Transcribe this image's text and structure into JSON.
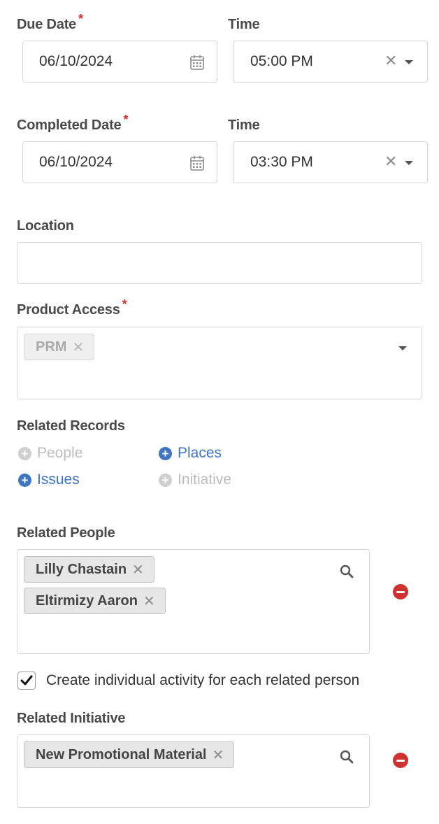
{
  "due": {
    "label": "Due Date",
    "required_mark": "*",
    "date_value": "06/10/2024",
    "time_label": "Time",
    "time_value": "05:00 PM"
  },
  "completed": {
    "label": "Completed Date",
    "required_mark": "*",
    "date_value": "06/10/2024",
    "time_label": "Time",
    "time_value": "03:30 PM"
  },
  "location": {
    "label": "Location",
    "value": ""
  },
  "product_access": {
    "label": "Product Access",
    "required_mark": "*",
    "tags": [
      "PRM"
    ]
  },
  "related_records": {
    "label": "Related Records",
    "items": [
      {
        "label": "People",
        "state": "disabled"
      },
      {
        "label": "Places",
        "state": "active"
      },
      {
        "label": "Issues",
        "state": "active"
      },
      {
        "label": "Initiative",
        "state": "disabled"
      }
    ]
  },
  "related_people": {
    "label": "Related People",
    "tags": [
      "Lilly Chastain",
      "Eltirmizy Aaron"
    ]
  },
  "individual_activity": {
    "label": "Create individual activity for each related person",
    "checked": true
  },
  "related_initiative": {
    "label": "Related Initiative",
    "tags": [
      "New Promotional Material"
    ]
  },
  "icons": {
    "calendar": "calendar-icon",
    "clear": "clear-x-icon",
    "dropdown": "chevron-down-icon",
    "search": "search-icon",
    "remove": "remove-circle-icon",
    "add": "plus-circle-icon",
    "check": "checkmark-icon"
  },
  "colors": {
    "required": "#d0312d",
    "link": "#3e76c2",
    "remove": "#cf3030",
    "disabled": "#bdbdbd"
  }
}
